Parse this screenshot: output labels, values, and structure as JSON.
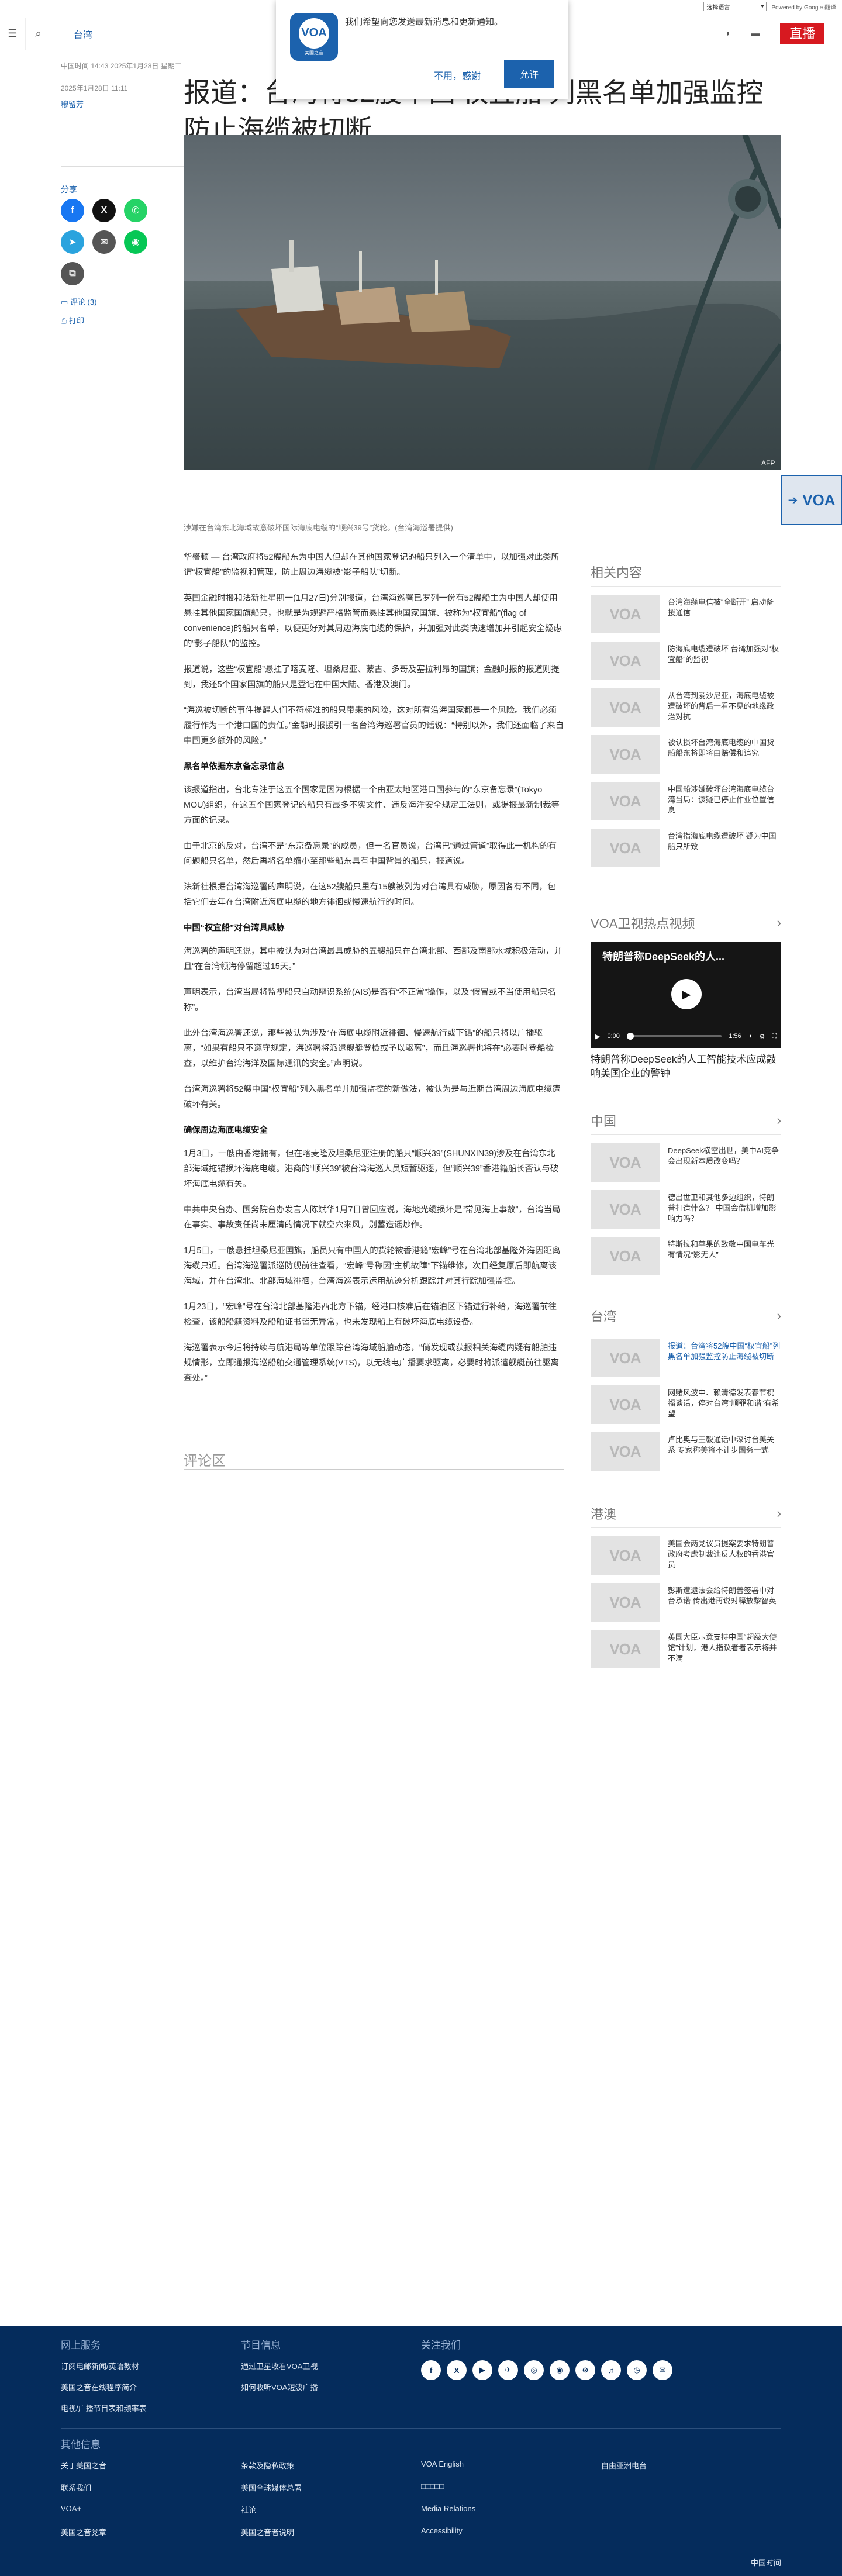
{
  "lang_bar": {
    "select_label": "选择语言",
    "powered": "Powered by Google 翻译"
  },
  "header": {
    "section": "台湾",
    "live": "直播"
  },
  "prompt": {
    "logo": "VOA",
    "logo_sub": "美国之音",
    "message": "我们希望向您发送最新消息和更新通知。",
    "decline": "不用，感谢",
    "accept": "允许"
  },
  "article": {
    "date_line": "中国时间 14:43 2025年1月28日 星期二",
    "date_line2": "2025年1月28日 11:11",
    "author": "穆留芳",
    "title": "报道：台湾将52艘中国‘权宜船’列黑名单加强监控防止海缆被切断",
    "share_label": "分享",
    "comments": "评论 (3)",
    "print": "打印",
    "caption": "涉嫌在台湾东北海域故意破坏国际海底电缆的“顺兴39号”货轮。(台湾海巡署提供)",
    "paragraphs": [
      "华盛顿 — 台湾政府将52艘船东为中国人但却在其他国家登记的船只列入一个清单中，以加强对此类所谓“权宜船”的监视和管理，防止周边海缆被“影子船队”切断。",
      "英国金融时报和法新社星期一(1月27日)分别报道，台湾海巡署已罗列一份有52艘船主为中国人却使用悬挂其他国家国旗船只，也就是为规避严格监管而悬挂其他国家国旗、被称为“权宜船”(flag of convenience)的船只名单，以便更好对其周边海底电缆的保护，并加强对此类快速增加并引起安全疑虑的“影子船队”的监控。",
      "报道说，这些“权宜船”悬挂了喀麦隆、坦桑尼亚、蒙古、多哥及塞拉利昂的国旗；金融时报的报道则提到，我还5个国家国旗的船只是登记在中国大陆、香港及澳门。",
      "“海巡被切断的事件提醒人们不符标准的船只带来的风险，这对所有沿海国家都是一个风险。我们必须履行作为一个港口国的责任。”金融时报援引一名台湾海巡署官员的话说：“特别以外，我们还面临了来自中国更多额外的风险。”"
    ],
    "heading1": "黑名单依据东京备忘录信息",
    "paragraphs2": [
      "该报道指出，台北专注于这五个国家是因为根据一个由亚太地区港口国参与的“东京备忘录”(Tokyo MOU)组织，在这五个国家登记的船只有最多不实文件、违反海洋安全规定工法则，或提报最新制裁等方面的记录。",
      "由于北京的反对，台湾不是“东京备忘录”的成员，但一名官员说，台湾巴“通过管道”取得此一机构的有问题船只名单，然后再将名单缩小至那些船东具有中国背景的船只，报道说。",
      "法新社根据台湾海巡署的声明说，在这52艘船只里有15艘被列为对台湾具有威胁，原因各有不同，包括它们去年在台湾附近海底电缆的地方徘徊或慢速航行的时间。"
    ],
    "heading2": "中国“权宜船”对台湾具威胁",
    "paragraphs3": [
      "海巡署的声明还说，其中被认为对台湾最具威胁的五艘船只在台湾北部、西部及南部水域积极活动，并且“在台湾领海停留超过15天。”",
      "声明表示，台湾当局将监视船只自动辨识系统(AIS)是否有“不正常”操作，以及“假冒或不当使用船只名称”。",
      "此外台湾海巡署还说，那些被认为涉及“在海底电缆附近徘徊、慢速航行或下锚”的船只将以广播驱离，“如果有船只不遵守规定，海巡署将派遣舰艇登检或予以驱离”，而且海巡署也将在“必要时登船检查，以维护台湾海洋及国际通讯的安全。”声明说。",
      "台湾海巡署将52艘中国“权宜船”列入黑名单并加强监控的新做法，被认为是与近期台湾周边海底电缆遭破坏有关。"
    ],
    "heading3": "确保周边海底电缆安全",
    "paragraphs4": [
      "1月3日，一艘由香港拥有，但在喀麦隆及坦桑尼亚注册的船只“顺兴39”(SHUNXIN39)涉及在台湾东北部海域拖锚损坏海底电缆。港商的“顺兴39”被台湾海巡人员短暂驱逐，但“顺兴39”香港籍船长否认与破坏海底电缆有关。",
      "中共中央台办、国务院台办发言人陈斌华1月7日曾回应说，海地光缆损坏是“常见海上事故”，台湾当局在事实、事故责任尚未厘清的情况下就空穴来风，别蓄造谣炒作。",
      "1月5日，一艘悬挂坦桑尼亚国旗，船员只有中国人的货轮被香港籍“宏峰”号在台湾北部基隆外海因距离海缆只近。台湾海巡署派巡防舰前往查看，“宏峰”号称因“主机故障”下锚维修，次日经复原后即航离该海域，并在台湾北、北部海域徘徊，台湾海巡表示运用航迹分析跟踪并对其行踪加强监控。",
      "1月23日，“宏峰”号在台湾北部基隆港西北方下锚，经港口核准后在锚泊区下锚进行补给，海巡署前往检查，该船船籍资料及船舶证书皆无异常，也未发现船上有破坏海底电缆设备。",
      "海巡署表示今后将持续与航港局等单位跟踪台湾海域船舶动态，“倘发现或获报相关海缆内疑有船舶违规情形，立即通报海巡船舶交通管理系统(VTS)，以无线电广播要求驱离，必要时将派遣舰艇前往驱离查处。”"
    ],
    "comment_zone": "评论区"
  },
  "sidebar": {
    "related_title": "相关内容",
    "related": [
      "台湾海缆电信被“全断开” 启动备援通信",
      "防海底电缆遭破坏 台湾加强对“权宜船”的监视",
      "从台湾到爱沙尼亚，海底电缆被遭破坏的背后一看不见的地缘政治对抗",
      "被认损坏台湾海底电缆的中国货船船东将即将由赔偿和追究",
      "中国船涉嫌破坏台湾海底电缆台湾当局：该疑已停止作业位置信息",
      "台湾指海底电缆遭破坏 疑为中国船只所致"
    ],
    "video_section_title": "VOA卫视热点视频",
    "video_title": "特朗普称DeepSeek的人...",
    "video_time_current": "0:00",
    "video_time_total": "1:56",
    "video_caption": "特朗普称DeepSeek的人工智能技术应成敲响美国企业的警钟",
    "china_title": "中国",
    "china": [
      "DeepSeek横空出世，美中AI竞争会出现新本质改变吗？",
      "德出世卫和其他多边组织，特朗普打造什么？ 中国会借机增加影响力吗？",
      "特斯拉和苹果的致敬中国电车光有情况“影无人”"
    ],
    "taiwan_title": "台湾",
    "taiwan": [
      "报道：台湾将52艘中国“权宜船”列黑名单加强监控防止海缆被切断",
      "网赌风波中、赖清德发表春节祝福谈话，停对台湾“顺罪和谐”有希望",
      "卢比奥与王毅通话中深讨台美关系 专家称美将不让步国务一式"
    ],
    "hk_title": "港澳",
    "hk": [
      "美国会两党议员提案要求特朗普政府考虑制裁违反人权的香港官员",
      "彭斯遭逮法会给特朗普签署中对台承诺 传出港再说对释放黎智英",
      "英国大臣示意支持中国“超级大使馆”计划，港人指议者者表示将并不满"
    ]
  },
  "floater": {
    "logo": "VOA"
  },
  "footer": {
    "online_title": "网上服务",
    "online": [
      "订阅电邮新闻/英语教材",
      "美国之音在线程序简介",
      "电视/广播节目表和频率表"
    ],
    "receive_title": "节目信息",
    "receive": [
      "通过卫星收看VOA卫视",
      "如何收听VOA短波广播"
    ],
    "follow_title": "关注我们",
    "social": [
      "f",
      "X",
      "▶",
      "✈",
      "◎",
      "◉",
      "⊙",
      "♫",
      "◷",
      "✉"
    ],
    "other_title": "其他信息",
    "col1": [
      "关于美国之音",
      "联系我们",
      "VOA+",
      "美国之音党章"
    ],
    "col2": [
      "条款及隐私政策",
      "美国全球媒体总署",
      "社论",
      "美国之音者说明"
    ],
    "col3": [
      "VOA English",
      "□□□□□",
      "Media Relations",
      "Accessibility"
    ],
    "col4": [
      "自由亚洲电台"
    ],
    "time_footer": "中国时间"
  }
}
